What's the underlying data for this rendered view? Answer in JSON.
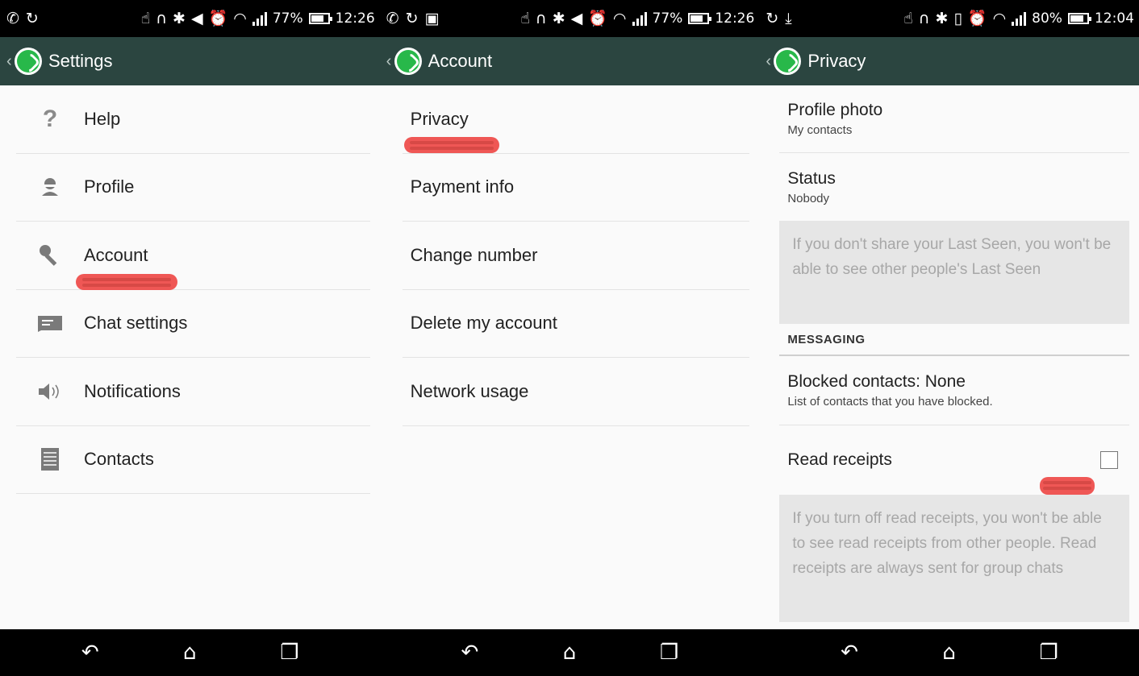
{
  "status_bars": [
    {
      "battery": "77%",
      "time": "12:26"
    },
    {
      "battery": "77%",
      "time": "12:26"
    },
    {
      "battery": "80%",
      "time": "12:04"
    }
  ],
  "settings": {
    "title": "Settings",
    "items": [
      {
        "label": "Help",
        "icon": "help-icon",
        "glyph": "?"
      },
      {
        "label": "Profile",
        "icon": "profile-icon",
        "glyph": "☺"
      },
      {
        "label": "Account",
        "icon": "key-icon",
        "glyph": "⚿"
      },
      {
        "label": "Chat settings",
        "icon": "chat-icon",
        "glyph": "▬"
      },
      {
        "label": "Notifications",
        "icon": "speaker-icon",
        "glyph": "🔈"
      },
      {
        "label": "Contacts",
        "icon": "contacts-icon",
        "glyph": "☰"
      }
    ]
  },
  "account": {
    "title": "Account",
    "items": [
      {
        "label": "Privacy"
      },
      {
        "label": "Payment info"
      },
      {
        "label": "Change number"
      },
      {
        "label": "Delete my account"
      },
      {
        "label": "Network usage"
      }
    ]
  },
  "privacy": {
    "title": "Privacy",
    "profile_photo": {
      "title": "Profile photo",
      "value": "My contacts"
    },
    "status": {
      "title": "Status",
      "value": "Nobody"
    },
    "last_seen_note": "If you don't share your Last Seen, you won't be able to see other people's Last Seen",
    "messaging_header": "MESSAGING",
    "blocked": {
      "title": "Blocked contacts: None",
      "subtitle": "List of contacts that you have blocked."
    },
    "read_receipts": {
      "title": "Read receipts",
      "checked": false
    },
    "read_receipts_note": "If you turn off read receipts, you won't be able to see read receipts from other people. Read receipts are always sent for group chats"
  },
  "colors": {
    "action_bar": "#2b4540",
    "whatsapp_green": "#28b84a",
    "highlight_scribble": "#ef4a48"
  }
}
